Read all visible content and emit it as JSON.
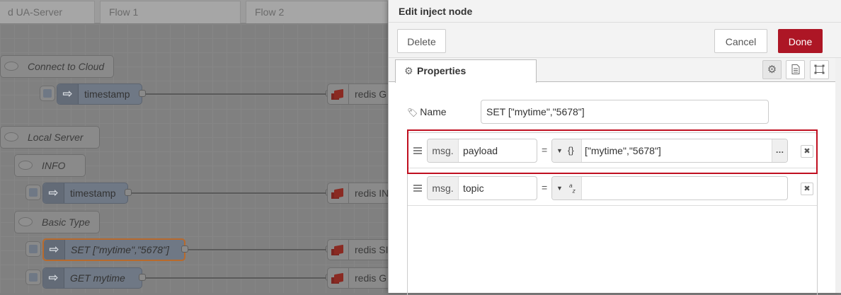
{
  "workspace": {
    "tabs": [
      "d UA-Server",
      "Flow 1",
      "Flow 2"
    ],
    "comments": {
      "connect": "Connect to Cloud",
      "local": "Local Server",
      "info": "INFO",
      "basic": "Basic Type"
    },
    "nodes": {
      "timestamp1": "timestamp",
      "timestamp2": "timestamp",
      "set": "SET [\"mytime\",\"5678\"]",
      "get": "GET mytime"
    },
    "redis": {
      "r1": "redis G",
      "r2": "redis IN",
      "r3": "redis SI",
      "r4": "redis G"
    }
  },
  "tray": {
    "title": "Edit inject node",
    "delete_label": "Delete",
    "cancel_label": "Cancel",
    "done_label": "Done",
    "properties_tab": "Properties",
    "name_label": "Name",
    "name_value": "SET [\"mytime\",\"5678\"]",
    "rules": [
      {
        "prefix": "msg.",
        "property": "payload",
        "equals": "=",
        "type_glyph": "{}",
        "value": "[\"mytime\",\"5678\"]"
      },
      {
        "prefix": "msg.",
        "property": "topic",
        "equals": "=",
        "type_glyph": "az",
        "value": ""
      }
    ]
  },
  "colors": {
    "done_button": "#ad1625",
    "highlight_border": "#c00f20"
  }
}
